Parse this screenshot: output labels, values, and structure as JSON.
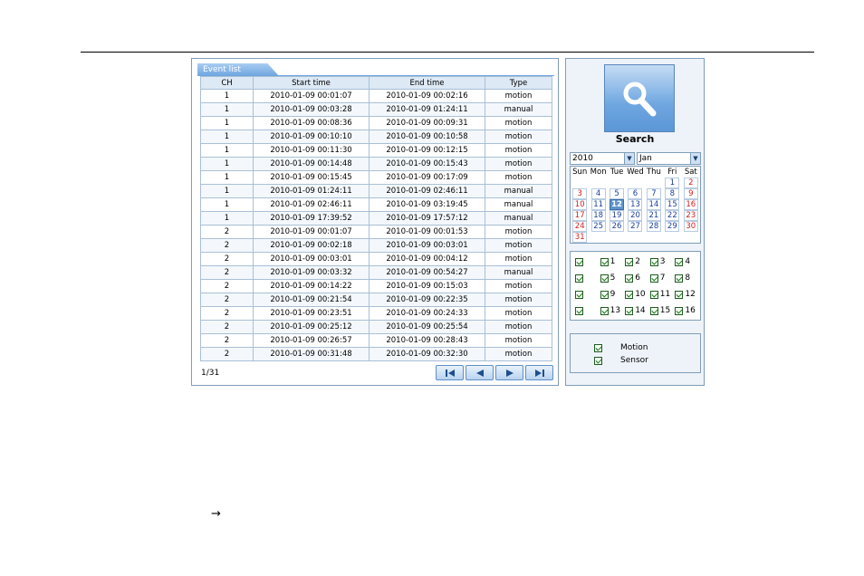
{
  "event_list": {
    "tab_label": "Event list",
    "columns": [
      "CH",
      "Start time",
      "End time",
      "Type"
    ],
    "rows": [
      [
        "1",
        "2010-01-09 00:01:07",
        "2010-01-09 00:02:16",
        "motion"
      ],
      [
        "1",
        "2010-01-09 00:03:28",
        "2010-01-09 01:24:11",
        "manual"
      ],
      [
        "1",
        "2010-01-09 00:08:36",
        "2010-01-09 00:09:31",
        "motion"
      ],
      [
        "1",
        "2010-01-09 00:10:10",
        "2010-01-09 00:10:58",
        "motion"
      ],
      [
        "1",
        "2010-01-09 00:11:30",
        "2010-01-09 00:12:15",
        "motion"
      ],
      [
        "1",
        "2010-01-09 00:14:48",
        "2010-01-09 00:15:43",
        "motion"
      ],
      [
        "1",
        "2010-01-09 00:15:45",
        "2010-01-09 00:17:09",
        "motion"
      ],
      [
        "1",
        "2010-01-09 01:24:11",
        "2010-01-09 02:46:11",
        "manual"
      ],
      [
        "1",
        "2010-01-09 02:46:11",
        "2010-01-09 03:19:45",
        "manual"
      ],
      [
        "1",
        "2010-01-09 17:39:52",
        "2010-01-09 17:57:12",
        "manual"
      ],
      [
        "2",
        "2010-01-09 00:01:07",
        "2010-01-09 00:01:53",
        "motion"
      ],
      [
        "2",
        "2010-01-09 00:02:18",
        "2010-01-09 00:03:01",
        "motion"
      ],
      [
        "2",
        "2010-01-09 00:03:01",
        "2010-01-09 00:04:12",
        "motion"
      ],
      [
        "2",
        "2010-01-09 00:03:32",
        "2010-01-09 00:54:27",
        "manual"
      ],
      [
        "2",
        "2010-01-09 00:14:22",
        "2010-01-09 00:15:03",
        "motion"
      ],
      [
        "2",
        "2010-01-09 00:21:54",
        "2010-01-09 00:22:35",
        "motion"
      ],
      [
        "2",
        "2010-01-09 00:23:51",
        "2010-01-09 00:24:33",
        "motion"
      ],
      [
        "2",
        "2010-01-09 00:25:12",
        "2010-01-09 00:25:54",
        "motion"
      ],
      [
        "2",
        "2010-01-09 00:26:57",
        "2010-01-09 00:28:43",
        "motion"
      ],
      [
        "2",
        "2010-01-09 00:31:48",
        "2010-01-09 00:32:30",
        "motion"
      ]
    ],
    "page_indicator": "1/31",
    "pager_icons": [
      "first-page-icon",
      "prev-page-icon",
      "next-page-icon",
      "last-page-icon"
    ]
  },
  "search": {
    "label": "Search",
    "icon": "magnifier-icon",
    "year": "2010",
    "month": "Jan",
    "weekdays": [
      "Sun",
      "Mon",
      "Tue",
      "Wed",
      "Thu",
      "Fri",
      "Sat"
    ],
    "days": [
      "",
      "",
      "",
      "",
      "",
      "1",
      "2",
      "3",
      "4",
      "5",
      "6",
      "7",
      "8",
      "9",
      "10",
      "11",
      "12",
      "13",
      "14",
      "15",
      "16",
      "17",
      "18",
      "19",
      "20",
      "21",
      "22",
      "23",
      "24",
      "25",
      "26",
      "27",
      "28",
      "29",
      "30",
      "31"
    ],
    "selected_day": "12",
    "red_days": [
      "2",
      "3",
      "9",
      "10",
      "16",
      "17",
      "23",
      "24",
      "30",
      "31"
    ],
    "channels": [
      {
        "label": "",
        "checked": true
      },
      {
        "label": "1",
        "checked": true
      },
      {
        "label": "2",
        "checked": true
      },
      {
        "label": "3",
        "checked": true
      },
      {
        "label": "4",
        "checked": true
      },
      {
        "label": "",
        "checked": true
      },
      {
        "label": "5",
        "checked": true
      },
      {
        "label": "6",
        "checked": true
      },
      {
        "label": "7",
        "checked": true
      },
      {
        "label": "8",
        "checked": true
      },
      {
        "label": "",
        "checked": true
      },
      {
        "label": "9",
        "checked": true
      },
      {
        "label": "10",
        "checked": true
      },
      {
        "label": "11",
        "checked": true
      },
      {
        "label": "12",
        "checked": true
      },
      {
        "label": "",
        "checked": true
      },
      {
        "label": "13",
        "checked": true
      },
      {
        "label": "14",
        "checked": true
      },
      {
        "label": "15",
        "checked": true
      },
      {
        "label": "16",
        "checked": true
      }
    ],
    "event_types": [
      {
        "label": "Motion",
        "checked": true
      },
      {
        "label": "Sensor",
        "checked": true
      }
    ]
  },
  "page": {
    "arrow_glyph": "→"
  },
  "colors": {
    "accent": "#6ea5df",
    "border": "#7f9db9",
    "weekend_red": "#d21f1f",
    "selected_day_bg": "#5f95cc"
  }
}
